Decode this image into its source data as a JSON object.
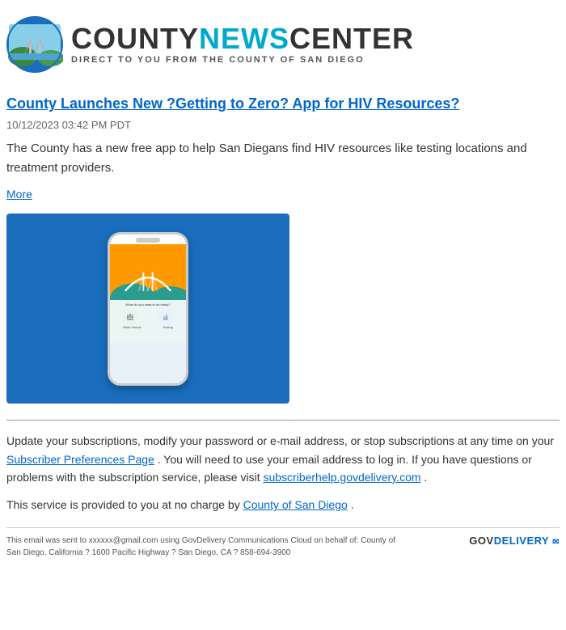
{
  "header": {
    "logo_alt": "County News Center logo",
    "title_part1": "COUNTY",
    "title_part2": "NEWS",
    "title_part3": "CENTER",
    "subtitle": "DIRECT TO YOU FROM THE COUNTY OF SAN DIEGO"
  },
  "article": {
    "title": "County Launches New ?Getting to Zero? App for HIV Resources?",
    "date": "10/12/2023 03:42 PM PDT",
    "body": "The County has a new free app to help San Diegans find HIV resources like testing locations and treatment providers.",
    "more_label": "More"
  },
  "footer": {
    "update_text": "Update your subscriptions, modify your password or e-mail address, or stop subscriptions at any time on your",
    "subscriber_link_text": "Subscriber Preferences Page",
    "update_text2": ". You will need to use your email address to log in. If you have questions or problems with the subscription service, please visit",
    "help_link_text": "subscriberhelp.govdelivery.com",
    "update_text3": ".",
    "service_text": "This service is provided to you at no charge by",
    "county_link_text": "County of San Diego",
    "service_text2": ".",
    "bottom_note": "This email was sent to xxxxxx@gmail.com using GovDelivery Communications Cloud on behalf of: County of San Diego, California ? 1600 Pacific Highway ? San Diego, CA ? 858-694-3900",
    "govdelivery_label": "GOVDELIVERY"
  }
}
